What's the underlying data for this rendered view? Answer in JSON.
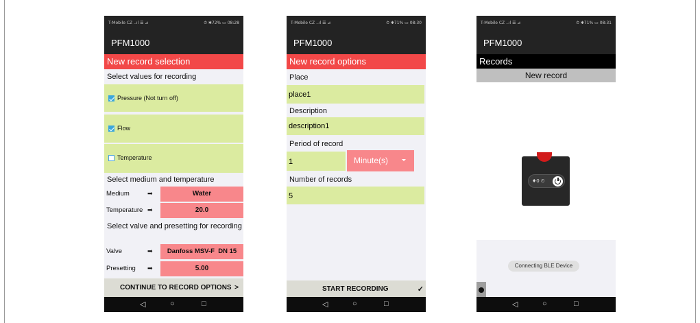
{
  "phone1": {
    "status_left": "T-Mobile CZ ..ıl ☰ ⊿",
    "status_right": "⏱ ✱72% ▭ 08:28",
    "app_title": "PFM1000",
    "header": "New record selection",
    "select_label": "Select values for recording",
    "checkboxes": [
      {
        "label": "Pressure (Not turn off)",
        "checked": true
      },
      {
        "label": "Flow",
        "checked": true
      },
      {
        "label": "Temperature",
        "checked": false
      }
    ],
    "medium_section": "Select medium and temperature",
    "medium_label": "Medium",
    "medium_value": "Water",
    "temperature_label": "Temperature",
    "temperature_value": "20.0",
    "valve_section": "Select valve and presetting for recording",
    "valve_label": "Valve",
    "valve_value": "Danfoss MSV-F  DN 15",
    "presetting_label": "Presetting",
    "presetting_value": "5.00",
    "arrow": "➡",
    "continue_label": "CONTINUE TO RECORD OPTIONS",
    "continue_chevron": ">"
  },
  "phone2": {
    "status_left": "T-Mobile CZ ..ıl ☰ ⊿",
    "status_right": "⏱ ✱71% ▭ 08:30",
    "app_title": "PFM1000",
    "header": "New record options",
    "place_label": "Place",
    "place_value": "place1",
    "description_label": "Description",
    "description_value": "description1",
    "period_label": "Period of record",
    "period_value": "1",
    "period_unit": "Minute(s)",
    "number_label": "Number of records",
    "number_value": "5",
    "start_label": "START RECORDING",
    "start_check": "✓"
  },
  "phone3": {
    "status_left": "T-Mobile CZ ..ıl ☰ ⊿",
    "status_right": "⏱ ✱71% ▭ 08:31",
    "app_title": "PFM1000",
    "header": "Records",
    "new_record": "New record",
    "device_text": "♦0 ⏲",
    "toast": "Connecting BLE Device"
  },
  "nav": {
    "back": "◁",
    "home": "○",
    "recents": "□"
  },
  "colors": {
    "red_header": "#f24848",
    "green_field": "#dbeba0",
    "pink_field": "#f8878b",
    "checkbox_blue": "#3ba7dc"
  }
}
